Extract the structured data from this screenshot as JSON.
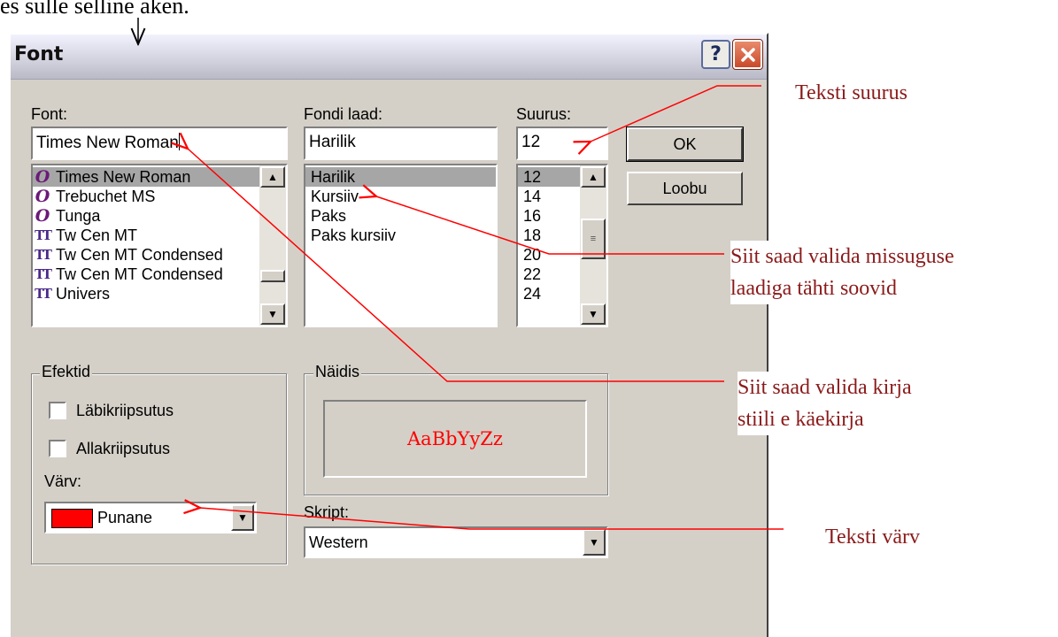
{
  "top_caption": "es sulle selline aken.",
  "dialog": {
    "title": "Font",
    "help_glyph": "?",
    "font": {
      "label": "Font:",
      "value": "Times New Roman",
      "items": [
        {
          "label": "Times New Roman",
          "icon": "opentype-font-icon",
          "glyph": "O",
          "selected": true
        },
        {
          "label": "Trebuchet MS",
          "icon": "opentype-font-icon",
          "glyph": "O"
        },
        {
          "label": "Tunga",
          "icon": "opentype-font-icon",
          "glyph": "O"
        },
        {
          "label": "Tw Cen MT",
          "icon": "truetype-font-icon",
          "glyph": "TT"
        },
        {
          "label": "Tw Cen MT Condensed",
          "icon": "truetype-font-icon",
          "glyph": "TT"
        },
        {
          "label": "Tw Cen MT Condensed",
          "icon": "truetype-font-icon",
          "glyph": "TT"
        },
        {
          "label": "Univers",
          "icon": "truetype-font-icon",
          "glyph": "TT"
        }
      ]
    },
    "style": {
      "label": "Fondi laad:",
      "value": "Harilik",
      "items": [
        "Harilik",
        "Kursiiv",
        "Paks",
        "Paks kursiiv"
      ],
      "selected": "Harilik"
    },
    "size": {
      "label": "Suurus:",
      "value": "12",
      "items": [
        "12",
        "14",
        "16",
        "18",
        "20",
        "22",
        "24"
      ],
      "selected": "12"
    },
    "ok_label": "OK",
    "cancel_label": "Loobu",
    "effects": {
      "label": "Efektid",
      "strikethrough_label": "Läbikriipsutus",
      "underline_label": "Allakriipsutus",
      "strikethrough_checked": false,
      "underline_checked": false,
      "color_label": "Värv:",
      "color_value": "Punane",
      "color_hex": "#ff0000"
    },
    "sample": {
      "label": "Näidis",
      "text": "AaBbYyZz",
      "color": "#ff0000"
    },
    "script": {
      "label": "Skript:",
      "value": "Western"
    }
  },
  "callouts": {
    "size": "Teksti suurus",
    "style_line1": "Siit saad valida missuguse",
    "style_line2": "laadiga tähti soovid",
    "font_line1": "Siit saad valida kirja",
    "font_line2": "stiili e käekirja",
    "color": "Teksti värv"
  },
  "colors": {
    "annotation_arrow": "#ff0000",
    "callout_text": "#8b1a1a",
    "dialog_face": "#d4d0c8",
    "selection": "#a6a6a6"
  }
}
